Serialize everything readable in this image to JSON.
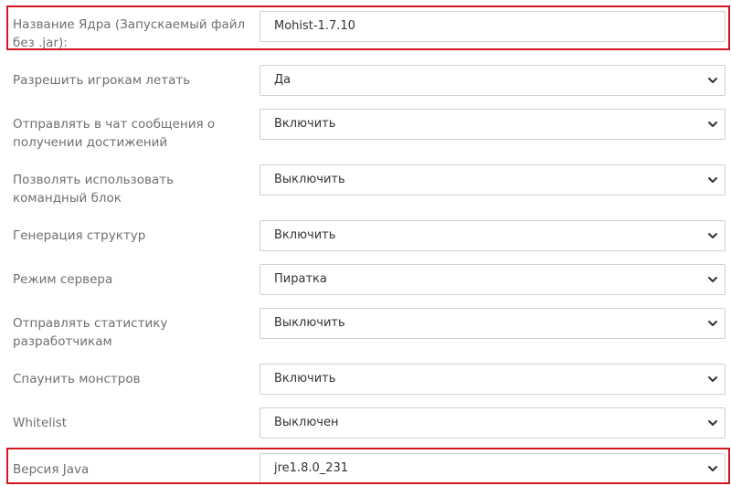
{
  "form": {
    "rows": [
      {
        "label": "Название Ядра (Запускаемый файл без .jar):",
        "value": "Mohist-1.7.10",
        "type": "text"
      },
      {
        "label": "Разрешить игрокам летать",
        "value": "Да",
        "type": "select"
      },
      {
        "label": "Отправлять в чат сообщения о получении достижений",
        "value": "Включить",
        "type": "select"
      },
      {
        "label": "Позволять использовать командный блок",
        "value": "Выключить",
        "type": "select"
      },
      {
        "label": "Генерация структур",
        "value": "Включить",
        "type": "select"
      },
      {
        "label": "Режим сервера",
        "value": "Пиратка",
        "type": "select"
      },
      {
        "label": "Отправлять статистику разработчикам",
        "value": "Выключить",
        "type": "select"
      },
      {
        "label": "Спаунить монстров",
        "value": "Включить",
        "type": "select"
      },
      {
        "label": "Whitelist",
        "value": "Выключен",
        "type": "select"
      },
      {
        "label": "Версия Java",
        "value": "jre1.8.0_231",
        "type": "select"
      }
    ]
  },
  "colors": {
    "highlight": "#d4161f"
  },
  "icons": {
    "dropdown": "chevron-down-icon"
  }
}
